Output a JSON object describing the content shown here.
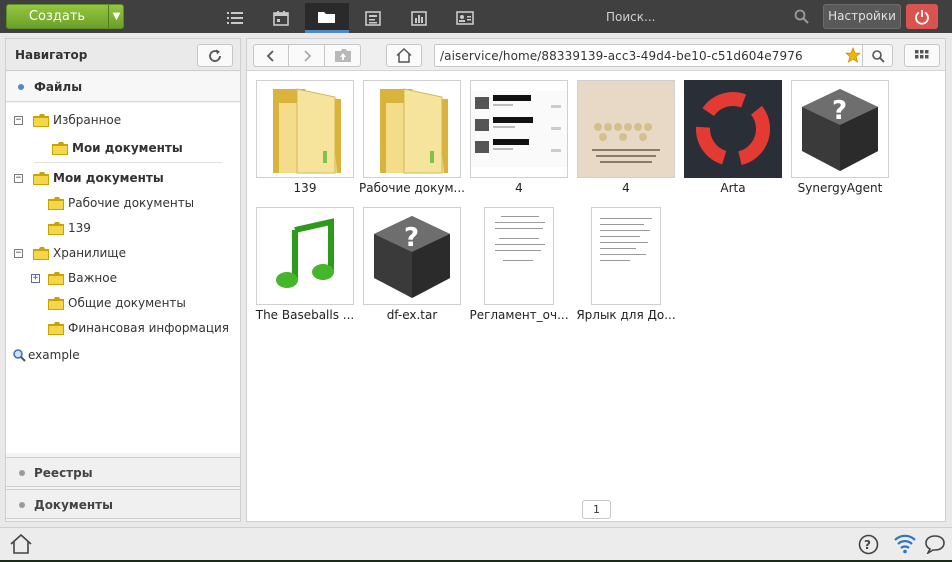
{
  "topbar": {
    "create_label": "Создать",
    "search_placeholder": "Поиск...",
    "settings_label": "Настройки",
    "nav_icons": [
      "list-icon",
      "calendar-icon",
      "folder-icon",
      "news-icon",
      "chart-icon",
      "contact-card-icon"
    ],
    "active_nav": "folder-icon"
  },
  "navigator": {
    "title": "Навигатор",
    "files_label": "Файлы",
    "tree": {
      "favorites": "Избранное",
      "fav_my_docs": "Мои документы",
      "my_docs": "Мои документы",
      "work_docs": "Рабочие документы",
      "f139": "139",
      "storage": "Хранилище",
      "important": "Важное",
      "common_docs": "Общие документы",
      "finance": "Финансовая информация",
      "search_item": "example"
    },
    "sections": {
      "registries": "Реестры",
      "documents": "Документы"
    }
  },
  "content": {
    "path": "/aiservice/home/88339139-acc3-49d4-be10-c51d604e7976",
    "files": [
      {
        "name": "139",
        "kind": "folder-icon"
      },
      {
        "name": "Рабочие докум...",
        "kind": "folder-icon"
      },
      {
        "name": "4",
        "kind": "screenshot-thumbnail"
      },
      {
        "name": "4",
        "kind": "photo-thumbnail"
      },
      {
        "name": "Arta",
        "kind": "arta-logo-thumbnail"
      },
      {
        "name": "SynergyAgent",
        "kind": "unknown-package-icon"
      },
      {
        "name": "The Baseballs ...",
        "kind": "music-note-icon"
      },
      {
        "name": "df-ex.tar",
        "kind": "unknown-package-icon"
      },
      {
        "name": "Регламент_оч...",
        "kind": "document-thumbnail"
      },
      {
        "name": "Ярлык для До...",
        "kind": "document-thumbnail"
      }
    ],
    "page": "1"
  },
  "colors": {
    "topbar_bg": "#404040",
    "create_green": "#7fb536",
    "active_blue": "#4d88c8",
    "power_red": "#d9534f",
    "arta_red": "#e33b33",
    "arta_bg": "#2a2f37"
  },
  "bottombar": {
    "icons": [
      "home-icon",
      "help-icon",
      "wifi-icon",
      "chat-icon"
    ]
  }
}
